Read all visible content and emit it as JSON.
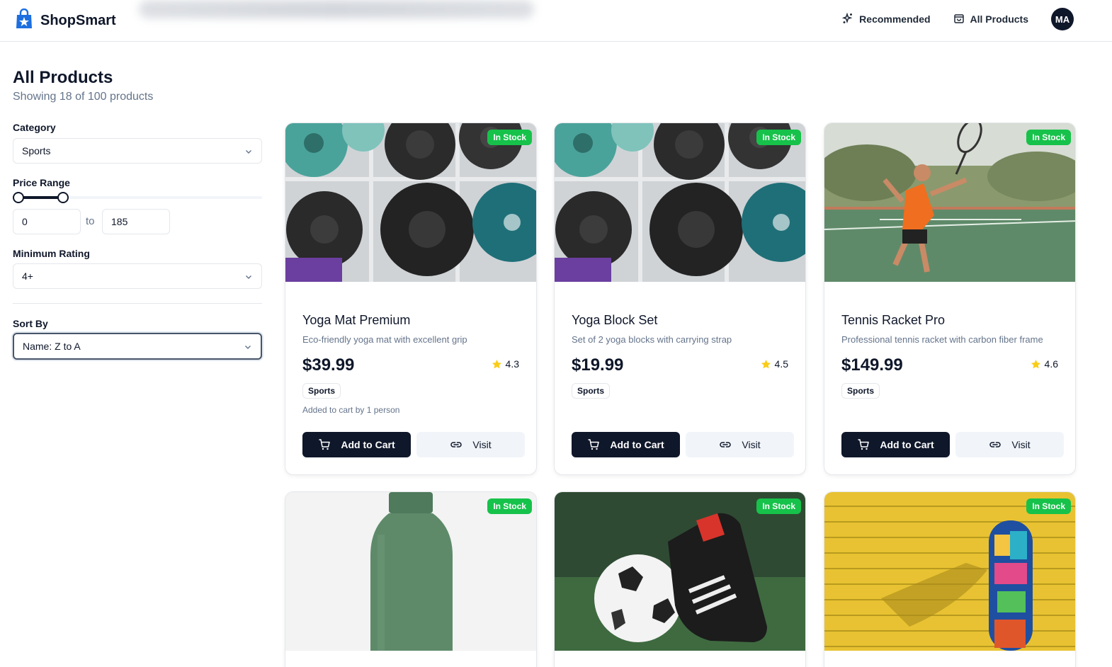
{
  "app": {
    "name": "ShopSmart"
  },
  "nav": {
    "recommended": "Recommended",
    "all_products": "All Products",
    "avatar_initials": "MA"
  },
  "page": {
    "title": "All Products",
    "subtitle": "Showing 18 of 100 products"
  },
  "filters": {
    "category_label": "Category",
    "category_value": "Sports",
    "price_label": "Price Range",
    "price_min": "0",
    "price_max": "185",
    "price_to": "to",
    "rating_label": "Minimum Rating",
    "rating_value": "4+",
    "sort_label": "Sort By",
    "sort_value": "Name: Z to A"
  },
  "products": [
    {
      "name": "Yoga Mat Premium",
      "description": "Eco-friendly yoga mat with excellent grip",
      "price": "$39.99",
      "rating": "4.3",
      "category": "Sports",
      "stock": "In Stock",
      "note": "Added to cart by 1 person",
      "cart_label": "Add to Cart",
      "visit_label": "Visit"
    },
    {
      "name": "Yoga Block Set",
      "description": "Set of 2 yoga blocks with carrying strap",
      "price": "$19.99",
      "rating": "4.5",
      "category": "Sports",
      "stock": "In Stock",
      "note": "",
      "cart_label": "Add to Cart",
      "visit_label": "Visit"
    },
    {
      "name": "Tennis Racket Pro",
      "description": "Professional tennis racket with carbon fiber frame",
      "price": "$149.99",
      "rating": "4.6",
      "category": "Sports",
      "stock": "In Stock",
      "note": "",
      "cart_label": "Add to Cart",
      "visit_label": "Visit"
    },
    {
      "stock": "In Stock"
    },
    {
      "stock": "In Stock"
    },
    {
      "stock": "In Stock"
    }
  ],
  "colors": {
    "primary": "#0f172a",
    "stock_badge": "#16c24a",
    "star": "#facc15",
    "muted_text": "#64748b"
  }
}
